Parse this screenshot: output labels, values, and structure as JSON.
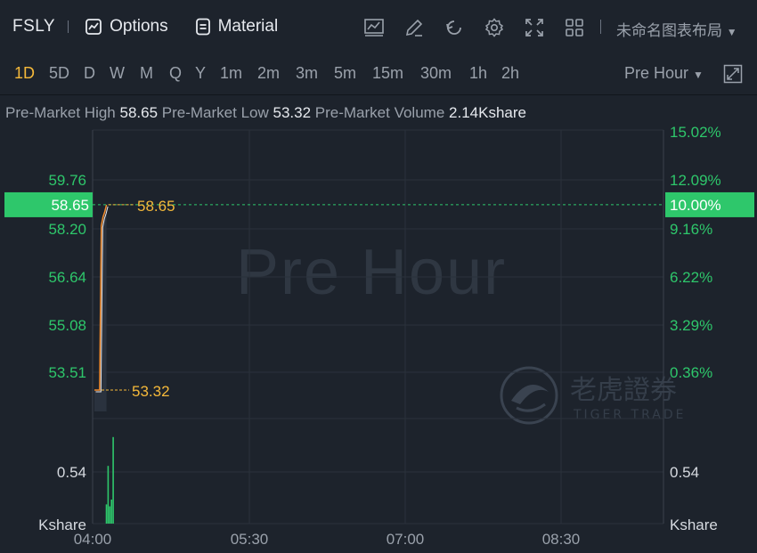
{
  "toolbar": {
    "ticker": "FSLY",
    "options_label": "Options",
    "material_label": "Material",
    "icons": [
      "chart-line-icon",
      "pen-icon",
      "refresh-icon",
      "gear-icon",
      "fullscreen-icon",
      "grid-icon"
    ],
    "layout_label": "未命名图表布局"
  },
  "timeframes": [
    "1D",
    "5D",
    "D",
    "W",
    "M",
    "Q",
    "Y",
    "1m",
    "2m",
    "3m",
    "5m",
    "15m",
    "30m",
    "1h",
    "2h"
  ],
  "active_timeframe": "1D",
  "session_label": "Pre Hour",
  "stats": {
    "high_label": "Pre-Market High",
    "high_value": "58.65",
    "low_label": "Pre-Market Low",
    "low_value": "53.32",
    "volume_label": "Pre-Market Volume",
    "volume_value": "2.14Kshare"
  },
  "watermark": "Pre Hour",
  "logo": {
    "cn": "老虎證券",
    "en": "TIGER TRADE"
  },
  "colors": {
    "up": "#2ec76b",
    "accent": "#f5b93a",
    "price_tag": "#2ec76b"
  },
  "chart_data": {
    "type": "line",
    "price_ticks_left": [
      "59.76",
      "58.20",
      "56.64",
      "55.08",
      "53.51"
    ],
    "percent_ticks_right": [
      "15.02%",
      "12.09%",
      "9.16%",
      "6.22%",
      "3.29%",
      "0.36%"
    ],
    "current_price": "58.65",
    "current_percent": "10.00%",
    "high_marker": "58.65",
    "low_marker": "53.32",
    "volume_tick": "0.54",
    "volume_unit": "Kshare",
    "x_ticks": [
      "04:00",
      "05:30",
      "07:00",
      "08:30"
    ],
    "price_series": [
      {
        "t": "04:00",
        "v": 53.32
      },
      {
        "t": "04:01",
        "v": 53.32
      },
      {
        "t": "04:02",
        "v": 53.32
      },
      {
        "t": "04:03",
        "v": 53.32
      },
      {
        "t": "04:04",
        "v": 58.05
      },
      {
        "t": "04:05",
        "v": 58.3
      },
      {
        "t": "04:06",
        "v": 58.45
      },
      {
        "t": "04:07",
        "v": 58.65
      }
    ],
    "volume_series": [
      0.0,
      0.0,
      0.0,
      0.2,
      0.6,
      0.18,
      0.25,
      0.9
    ],
    "price_range": [
      52.5,
      60.8
    ],
    "volume_range": [
      0,
      1.0
    ],
    "grid": true
  }
}
